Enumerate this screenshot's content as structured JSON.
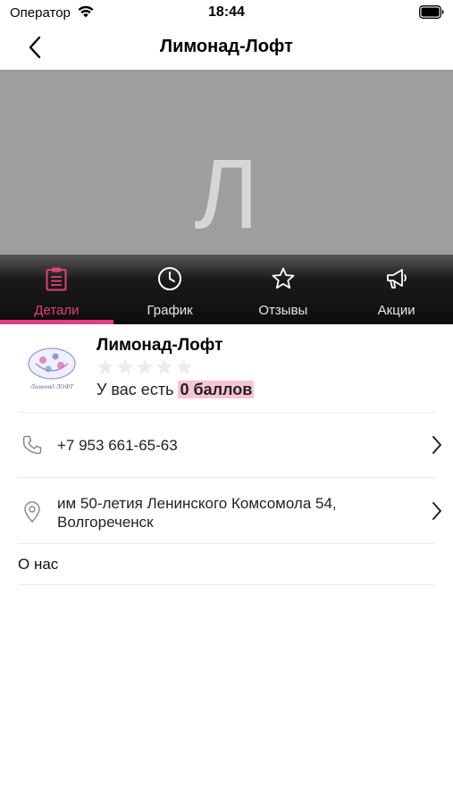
{
  "status_bar": {
    "carrier": "Оператор",
    "time": "18:44"
  },
  "nav": {
    "title": "Лимонад-Лофт"
  },
  "hero": {
    "placeholder_letter": "Л"
  },
  "tabs": [
    {
      "label": "Детали",
      "icon": "clipboard-icon",
      "active": true
    },
    {
      "label": "График",
      "icon": "clock-icon",
      "active": false
    },
    {
      "label": "Отзывы",
      "icon": "star-icon",
      "active": false
    },
    {
      "label": "Акции",
      "icon": "megaphone-icon",
      "active": false
    }
  ],
  "place": {
    "name": "Лимонад-Лофт",
    "rating": 0,
    "points_prefix": "У вас есть",
    "points_value": "0 баллов",
    "logo_text": "Лимонад ЛОФТ"
  },
  "contacts": {
    "phone": "+7 953 661-65-63",
    "address_line1": "им 50-летия Ленинского Комсомола 54,",
    "address_line2": "Волгореченск"
  },
  "about": {
    "label": "О нас"
  },
  "colors": {
    "accent": "#e0407f",
    "highlight": "#f7c4d6",
    "hero_bg": "#9e9e9e"
  }
}
